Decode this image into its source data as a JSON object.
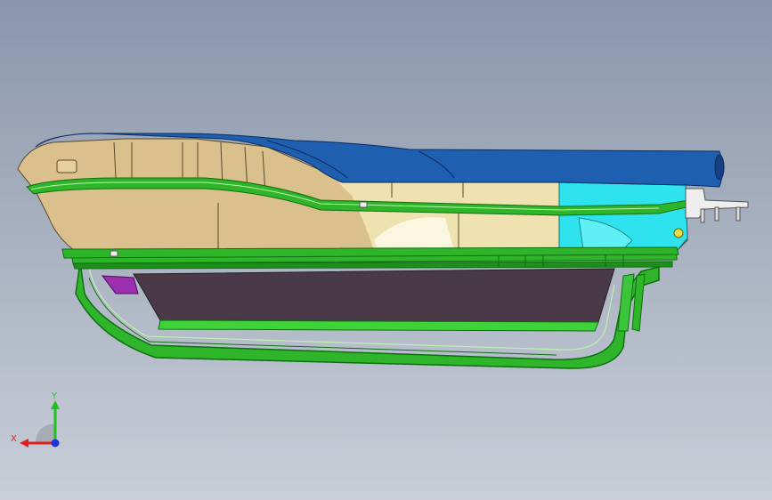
{
  "viewport": {
    "background_top": "#8a96ab",
    "background_bottom": "#c9ced8"
  },
  "model": {
    "view": "side view",
    "colors": {
      "body_tan": "#d9c08c",
      "body_tan_light": "#f1e4b6",
      "cover_blue": "#1f5fb0",
      "cyan_part": "#2fe3ee",
      "frame_green": "#2fb52a",
      "frame_green_dark": "#0f6e10",
      "panel_dark": "#4a3a48",
      "purple_part": "#9b2fb0",
      "white_bracket": "#eeeeee"
    }
  },
  "triad": {
    "icon": "coordinate-triad-icon",
    "x_label": "X",
    "y_label": "Y",
    "x_color": "#e02020",
    "y_color": "#20c020",
    "z_color": "#2030e0"
  }
}
